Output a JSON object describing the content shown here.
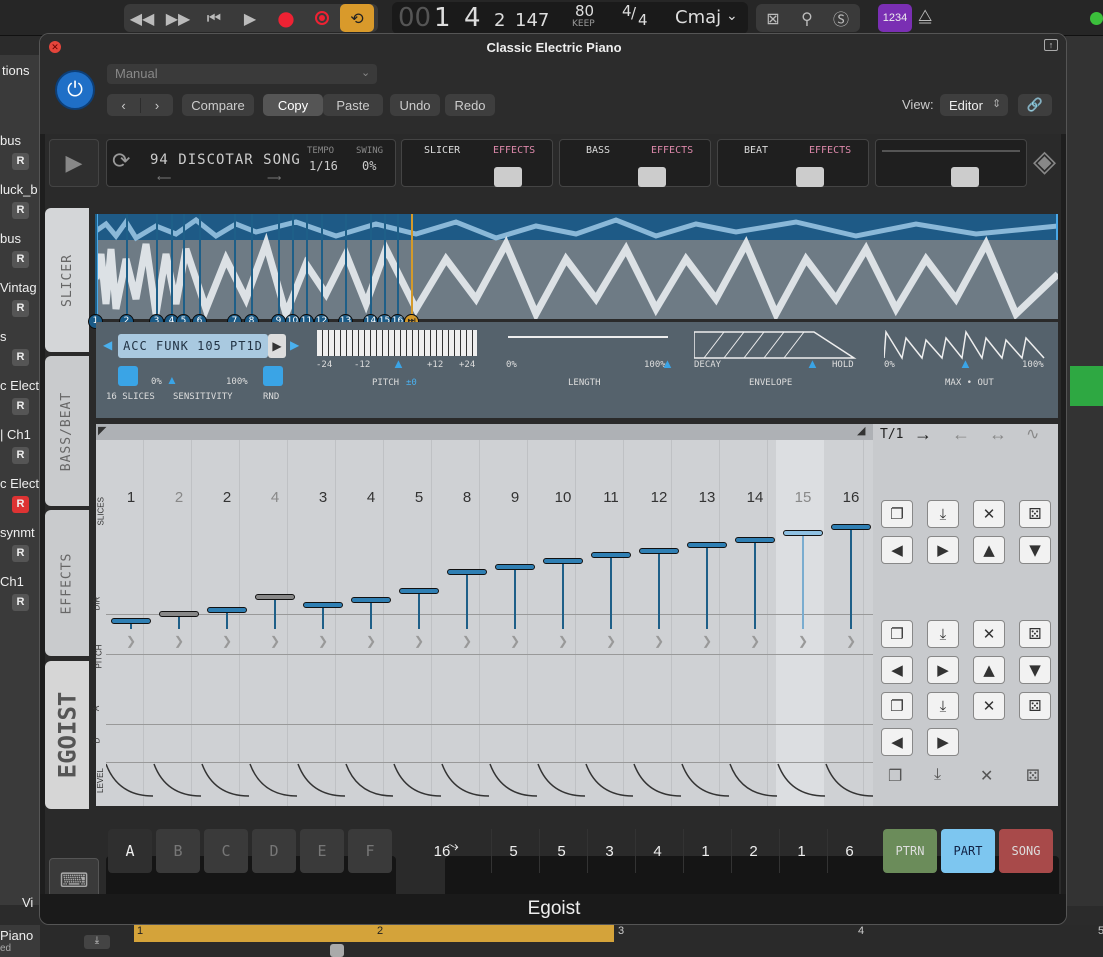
{
  "transport": {
    "rewind": "◀◀",
    "forward": "▶▶",
    "to_start": "⏮",
    "play": "▶",
    "record": "●",
    "position": "00",
    "bar": "1",
    "beat": "4",
    "div": "2",
    "tick": "147",
    "tempo": "80",
    "tempo_label": "KEEP",
    "sig_top": "4",
    "sig_bottom": "4",
    "key": "Cmaj",
    "badge": "1234"
  },
  "tracks": [
    "bus",
    "luck_b",
    "bus",
    "Vintag",
    "s",
    "c Elect",
    "| Ch1",
    "c Elect",
    "synmt",
    "Ch1"
  ],
  "left_top_label": "tions",
  "bottom_track": {
    "name": "Piano",
    "sub": "ed",
    "vi": "Vi"
  },
  "window": {
    "title": "Classic Electric Piano",
    "preset": "Manual",
    "compare": "Compare",
    "copy": "Copy",
    "paste": "Paste",
    "undo": "Undo",
    "redo": "Redo",
    "view_label": "View:",
    "view_value": "Editor"
  },
  "instrument": {
    "song_name": "94 DISCOTAR SONG",
    "tempo_label": "TEMPO",
    "tempo_value": "1/16",
    "swing_label": "SWING",
    "swing_value": "0%",
    "mixer": [
      {
        "name": "SLICER",
        "effects": "EFFECTS"
      },
      {
        "name": "BASS",
        "effects": "EFFECTS"
      },
      {
        "name": "BEAT",
        "effects": "EFFECTS"
      }
    ],
    "tabs": [
      "SLICER",
      "BASS/BEAT",
      "EFFECTS"
    ],
    "logo": "EGOIST",
    "slicer": {
      "markers": [
        "1",
        "2",
        "3",
        "4",
        "5",
        "6",
        "7",
        "8",
        "9",
        "10",
        "11",
        "12",
        "13",
        "14",
        "15",
        "16"
      ],
      "sample_name": "ACC FUNK 105 PT1D",
      "slices_label": "16 SLICES",
      "sens_label": "SENSITIVITY",
      "sens_min": "0%",
      "sens_max": "100%",
      "rnd_label": "RND",
      "pitch_ticks": [
        "-24",
        "-12",
        "+12",
        "+24"
      ],
      "pitch_label": "PITCH",
      "pitch_value": "±0",
      "length_min": "0%",
      "length_max": "100%",
      "length_label": "LENGTH",
      "env_decay": "DECAY",
      "env_hold": "HOLD",
      "env_label": "ENVELOPE",
      "max_min": "0%",
      "max_max": "100%",
      "max_label": "MAX • OUT"
    },
    "sequencer": {
      "step_numbers": [
        "1",
        "2",
        "2",
        "4",
        "3",
        "4",
        "5",
        "8",
        "9",
        "10",
        "11",
        "12",
        "13",
        "14",
        "15",
        "16"
      ],
      "slice_levels": [
        0.05,
        0.15,
        0.2,
        0.38,
        0.27,
        0.35,
        0.47,
        0.75,
        0.82,
        0.9,
        0.98,
        1.05,
        1.13,
        1.2,
        1.3,
        1.38
      ],
      "row_labels": [
        "SLICES",
        "DIR",
        "PITCH",
        "A",
        "D",
        "LEVEL"
      ],
      "header_right": "T/1"
    },
    "bottom": {
      "parts": [
        "A",
        "B",
        "C",
        "D",
        "E",
        "F"
      ],
      "length": "16",
      "steps": [
        "5",
        "5",
        "3",
        "4",
        "1",
        "2",
        "1",
        "6"
      ],
      "ptrn": "PTRN",
      "part": "PART",
      "song": "SONG"
    }
  },
  "footer_title": "Egoist",
  "ruler": {
    "m2": "2",
    "m3": "3",
    "m4": "4",
    "m5": "5"
  }
}
